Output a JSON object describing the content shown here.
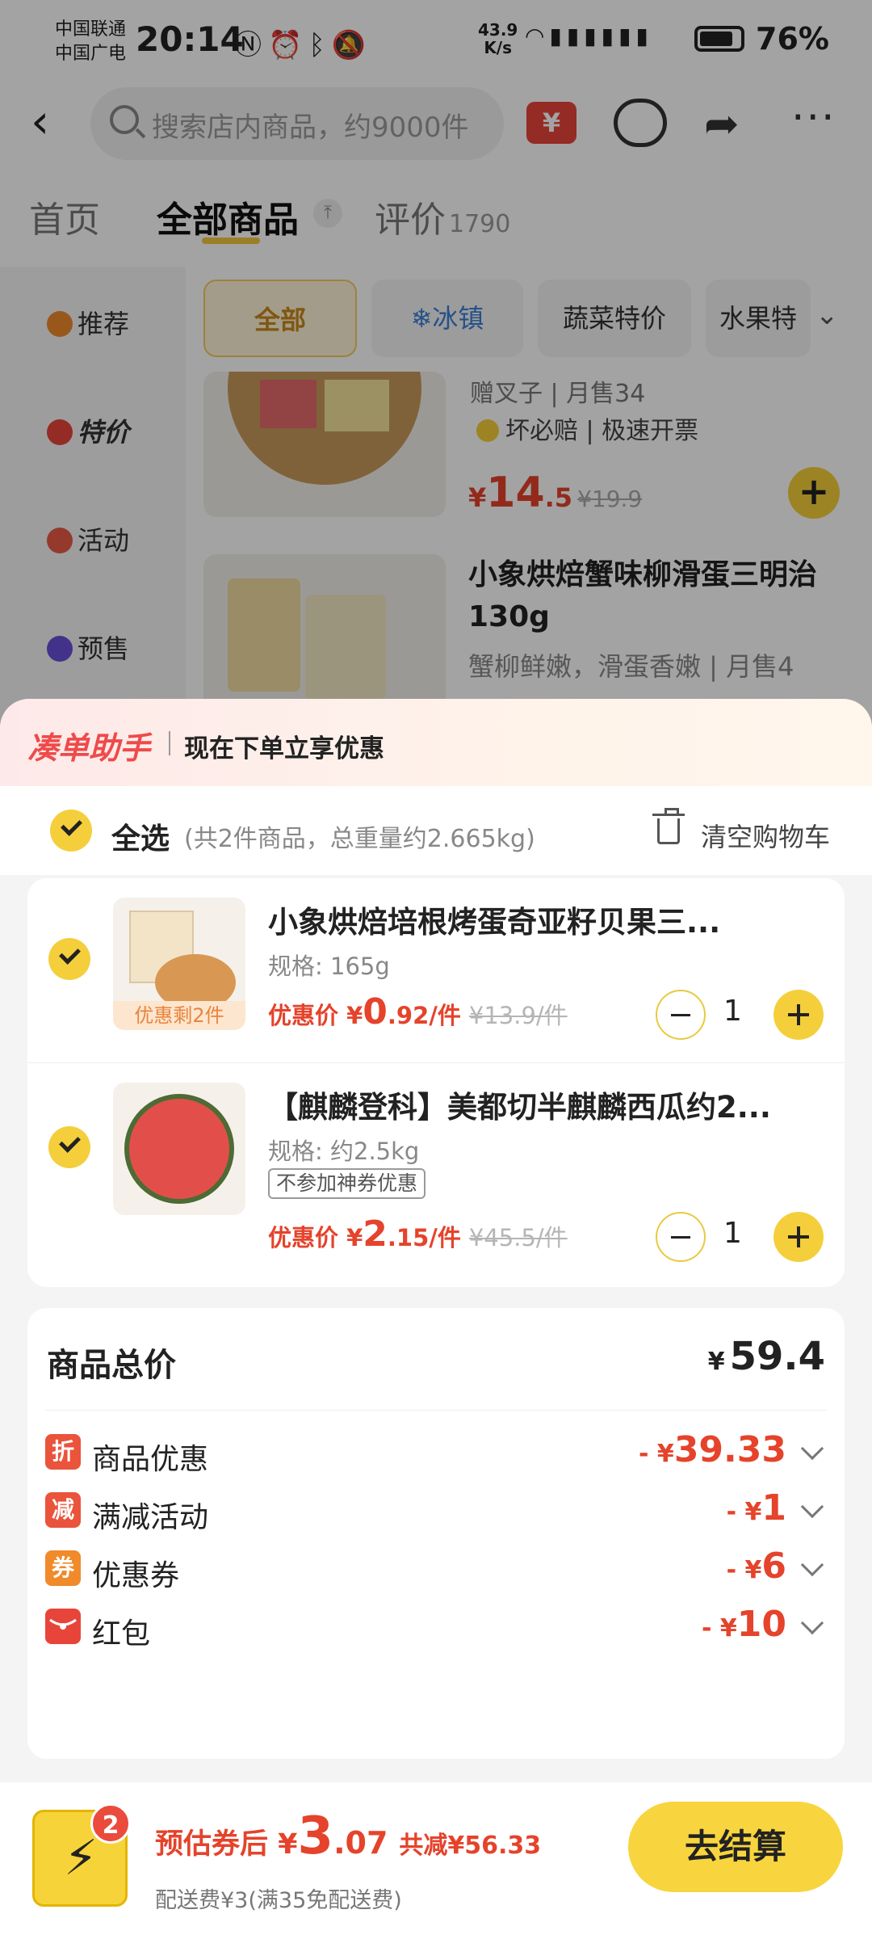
{
  "status_bar": {
    "carrier_1": "中国联通",
    "carrier_2": "中国广电",
    "time": "20:14",
    "net_speed_value": "43.9",
    "net_speed_unit": "K/s",
    "battery": "76%"
  },
  "nav": {
    "search_placeholder": "搜索店内商品，约9000件"
  },
  "tabs": [
    {
      "label": "首页"
    },
    {
      "label": "全部商品"
    },
    {
      "label": "评价",
      "count": "1790"
    }
  ],
  "categories": [
    {
      "label": "推荐"
    },
    {
      "label": "特价"
    },
    {
      "label": "活动"
    },
    {
      "label": "预售"
    }
  ],
  "chips": [
    {
      "label": "全部"
    },
    {
      "label": "❄冰镇"
    },
    {
      "label": "蔬菜特价"
    },
    {
      "label": "水果特"
    }
  ],
  "bg_product_1": {
    "tag_text": "赠叉子 | 月售34",
    "badges": "坏必赔 | 极速开票",
    "price_yen": "¥",
    "price_int": "14",
    "price_dec": ".5",
    "orig_price": "¥19.9"
  },
  "bg_product_2": {
    "title": "小象烘焙蟹味柳滑蛋三明治130g",
    "subtitle": "蟹柳鲜嫩，滑蛋香嫩 | 月售4"
  },
  "sheet": {
    "helper_title": "凑单助手",
    "helper_text": "现在下单立享优惠",
    "select_all": "全选",
    "select_meta": "(共2件商品，总重量约2.665kg)",
    "clear_cart": "清空购物车"
  },
  "cart_items": [
    {
      "title": "小象烘焙培根烤蛋奇亚籽贝果三...",
      "spec": "规格: 165g",
      "stock_tag": "优惠剩2件",
      "price_label": "优惠价 ¥",
      "price_int": "0",
      "price_dec": ".92/件",
      "orig_price": "¥13.9/件",
      "qty": "1"
    },
    {
      "title": "【麒麟登科】美都切半麒麟西瓜约2...",
      "spec": "规格: 约2.5kg",
      "promo_tag": "不参加神券优惠",
      "price_label": "优惠价 ¥",
      "price_int": "2",
      "price_dec": ".15/件",
      "orig_price": "¥45.5/件",
      "qty": "1"
    }
  ],
  "summary": {
    "total_label": "商品总价",
    "total_yen": "¥",
    "total_value": "59.4",
    "rows": [
      {
        "icon": "折",
        "label": "商品优惠",
        "prefix": "- ¥",
        "value": "39.33"
      },
      {
        "icon": "减",
        "label": "满减活动",
        "prefix": "- ¥",
        "value": "1"
      },
      {
        "icon": "券",
        "label": "优惠券",
        "prefix": "- ¥",
        "value": "6"
      },
      {
        "icon": "",
        "label": "红包",
        "prefix": "- ¥",
        "value": "10"
      }
    ]
  },
  "checkout": {
    "cart_count": "2",
    "est_label": "预估券后 ¥",
    "est_int": "3",
    "est_dec": ".07",
    "saved": "共减¥56.33",
    "shipping": "配送费¥3(满35免配送费)",
    "button": "去结算"
  },
  "colors": {
    "accent_yellow": "#f4cf3b",
    "price_red": "#e5432b",
    "helper_red": "#ef4a4a"
  }
}
